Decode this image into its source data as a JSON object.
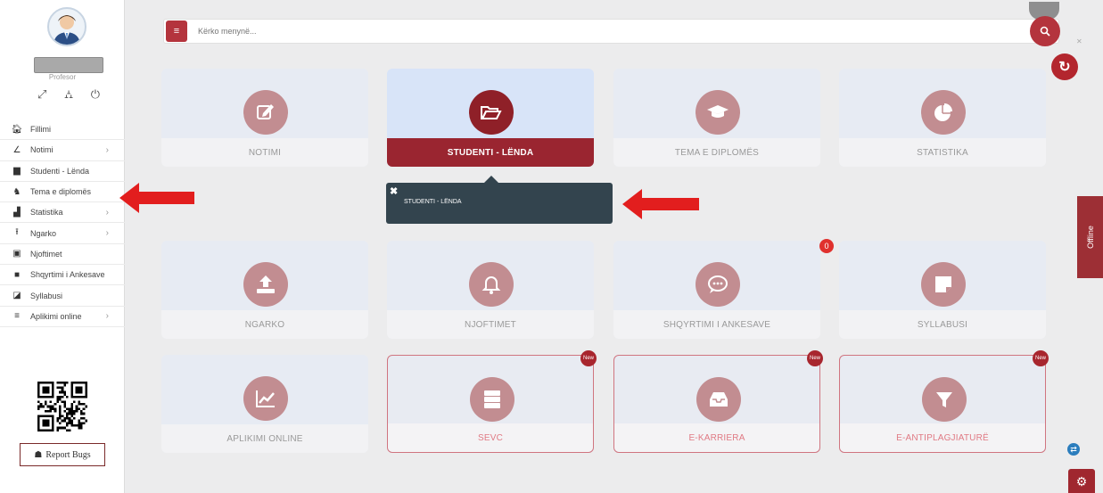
{
  "profile": {
    "role": "Profesor"
  },
  "sidebar": {
    "items": [
      {
        "label": "Fillimi",
        "icon": "home-icon",
        "glyph": "🏠︎",
        "has_chevron": false
      },
      {
        "label": "Notimi",
        "icon": "edit-icon",
        "glyph": "∠",
        "has_chevron": true
      },
      {
        "label": "Studenti - Lënda",
        "icon": "folder-icon",
        "glyph": "▆",
        "has_chevron": false
      },
      {
        "label": "Tema e diplomës",
        "icon": "graduation-cap-icon",
        "glyph": "♞",
        "has_chevron": false
      },
      {
        "label": "Statistika",
        "icon": "bar-chart-icon",
        "glyph": "▟",
        "has_chevron": true
      },
      {
        "label": "Ngarko",
        "icon": "upload-icon",
        "glyph": "⭱",
        "has_chevron": true
      },
      {
        "label": "Njoftimet",
        "icon": "calendar-icon",
        "glyph": "▣",
        "has_chevron": false
      },
      {
        "label": "Shqyrtimi i Ankesave",
        "icon": "comment-icon",
        "glyph": "■",
        "has_chevron": false
      },
      {
        "label": "Syllabusi",
        "icon": "note-icon",
        "glyph": "◪",
        "has_chevron": false
      },
      {
        "label": "Aplikimi online",
        "icon": "list-icon",
        "glyph": "≡",
        "has_chevron": true
      }
    ],
    "report_label": "Report Bugs"
  },
  "search": {
    "placeholder": "Kërko menynë..."
  },
  "tiles": [
    {
      "label": "NOTIMI",
      "icon": "edit-icon"
    },
    {
      "label": "STUDENTI - LËNDA",
      "icon": "folder-open-icon"
    },
    {
      "label": "TEMA E DIPLOMËS",
      "icon": "graduation-cap-icon"
    },
    {
      "label": "STATISTIKA",
      "icon": "pie-chart-icon"
    },
    {
      "label": "NGARKO",
      "icon": "upload-icon"
    },
    {
      "label": "NJOFTIMET",
      "icon": "bell-icon"
    },
    {
      "label": "SHQYRTIMI I ANKESAVE",
      "icon": "comment-dots-icon"
    },
    {
      "label": "SYLLABUSI",
      "icon": "sticky-note-icon"
    },
    {
      "label": "APLIKIMI ONLINE",
      "icon": "line-chart-icon"
    },
    {
      "label": "SEVC",
      "icon": "server-icon",
      "badge": "New"
    },
    {
      "label": "E-KARRIERA",
      "icon": "inbox-icon",
      "badge": "New"
    },
    {
      "label": "E-ANTIPLAGJIATURË",
      "icon": "filter-icon",
      "badge": "New"
    }
  ],
  "tooltip": {
    "text": "STUDENTI - LËNDA"
  },
  "notification_count": "0",
  "offline_label": "Offline",
  "colors": {
    "accent": "#9a2530",
    "tile_bg": "#e7ebf3",
    "icon_circle": "#c28d91",
    "tooltip_bg": "#33444e",
    "arrow": "#e21e1e"
  }
}
